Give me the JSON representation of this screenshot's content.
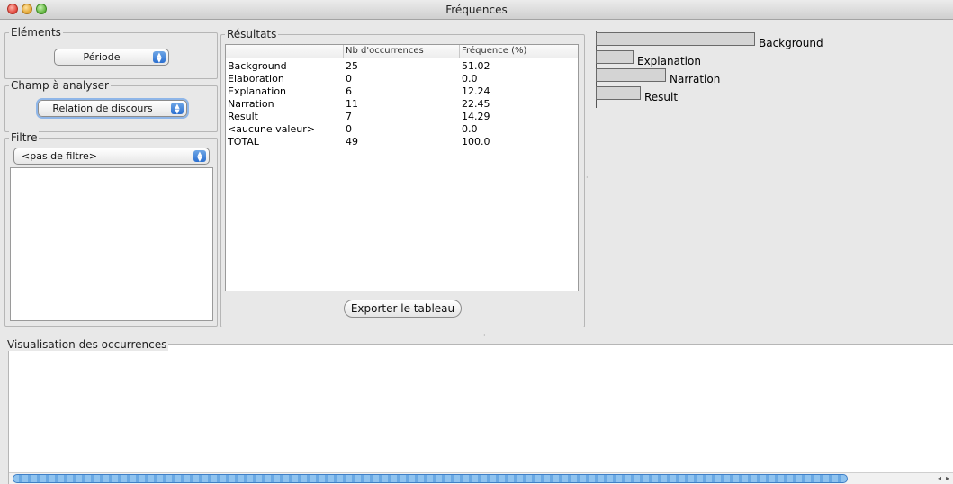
{
  "window": {
    "title": "Fréquences"
  },
  "elements_group": {
    "legend": "Eléments",
    "select_value": "Période"
  },
  "champ_group": {
    "legend": "Champ à analyser",
    "select_value": "Relation de discours"
  },
  "filtre_group": {
    "legend": "Filtre",
    "select_value": "<pas de filtre>"
  },
  "results": {
    "legend": "Résultats",
    "columns": [
      "",
      "Nb d'occurrences",
      "Fréquence (%)"
    ],
    "rows": [
      [
        "Background",
        "25",
        "51.02"
      ],
      [
        "Elaboration",
        "0",
        "0.0"
      ],
      [
        "Explanation",
        "6",
        "12.24"
      ],
      [
        "Narration",
        "11",
        "22.45"
      ],
      [
        "Result",
        "7",
        "14.29"
      ],
      [
        "<aucune valeur>",
        "0",
        "0.0"
      ],
      [
        "TOTAL",
        "49",
        "100.0"
      ]
    ],
    "export_button": "Exporter le tableau"
  },
  "chart_data": {
    "type": "bar",
    "orientation": "horizontal",
    "categories": [
      "Background",
      "Explanation",
      "Narration",
      "Result"
    ],
    "values": [
      25,
      6,
      11,
      7
    ],
    "max_value": 25,
    "bar_fill": "#d4d4d4",
    "bar_stroke": "#6a6a6a"
  },
  "visualisation": {
    "legend": "Visualisation des occurrences"
  },
  "colors": {
    "window_bg": "#e8e8e8",
    "scroll_thumb": "#6aa9e4"
  }
}
